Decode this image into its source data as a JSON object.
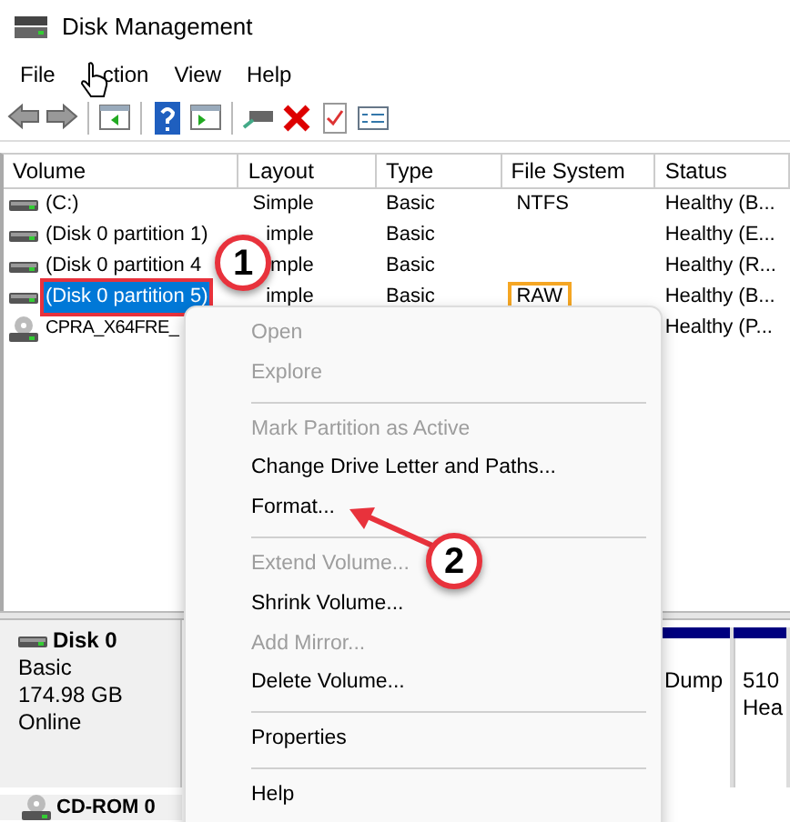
{
  "window": {
    "title": "Disk Management"
  },
  "menu": [
    "File",
    "ction",
    "View",
    "Help"
  ],
  "columns": [
    "Volume",
    "Layout",
    "Type",
    "File System",
    "Status"
  ],
  "rows": [
    {
      "volume": "(C:)",
      "layout": "Simple",
      "type": "Basic",
      "file_system": "NTFS",
      "status": "Healthy (B...",
      "kind": "disk",
      "selected": false,
      "volume_marked": false,
      "fs_marked": false
    },
    {
      "volume": "(Disk 0 partition 1)",
      "layout": "imple",
      "type": "Basic",
      "file_system": "",
      "status": "Healthy (E...",
      "kind": "disk",
      "selected": false,
      "volume_marked": false
    },
    {
      "volume": "(Disk 0 partition 4",
      "layout": "mple",
      "type": "Basic",
      "file_system": "",
      "status": "Healthy (R...",
      "kind": "disk",
      "selected": false,
      "volume_marked": false
    },
    {
      "volume": "(Disk 0 partition 5)",
      "layout": "imple",
      "type": "Basic",
      "file_system": "RAW",
      "status": "Healthy (B...",
      "kind": "disk",
      "selected": true,
      "volume_marked": true,
      "fs_marked": true
    },
    {
      "volume": "CPRA_X64FRE_",
      "layout": "",
      "type": "",
      "file_system": "",
      "status": "Healthy (P...",
      "kind": "cd",
      "selected": false,
      "volume_marked": false
    }
  ],
  "disks": [
    {
      "name": "Disk 0",
      "lines": [
        "Basic",
        "174.98 GB",
        "Online"
      ],
      "partitions": [
        {
          "lines": [
            "Dump"
          ]
        },
        {
          "lines": [
            "510",
            "Hea"
          ]
        }
      ]
    }
  ],
  "cdrom": {
    "name": "CD-ROM 0"
  },
  "context_menu": [
    {
      "kind": "item",
      "label": "Open",
      "disabled": true
    },
    {
      "kind": "item",
      "label": "Explore",
      "disabled": true
    },
    {
      "kind": "separator"
    },
    {
      "kind": "item",
      "label": "Mark Partition as Active",
      "disabled": true
    },
    {
      "kind": "item",
      "label": "Change Drive Letter and Paths...",
      "disabled": false
    },
    {
      "kind": "item",
      "label": "Format...",
      "disabled": false
    },
    {
      "kind": "separator"
    },
    {
      "kind": "item",
      "label": "Extend Volume...",
      "disabled": true
    },
    {
      "kind": "item",
      "label": "Shrink Volume...",
      "disabled": false
    },
    {
      "kind": "item",
      "label": "Add Mirror...",
      "disabled": true
    },
    {
      "kind": "item",
      "label": "Delete Volume...",
      "disabled": false
    },
    {
      "kind": "separator"
    },
    {
      "kind": "item",
      "label": "Properties",
      "disabled": false
    },
    {
      "kind": "separator"
    },
    {
      "kind": "item",
      "label": "Help",
      "disabled": false
    }
  ],
  "callouts": [
    "1",
    "2"
  ]
}
